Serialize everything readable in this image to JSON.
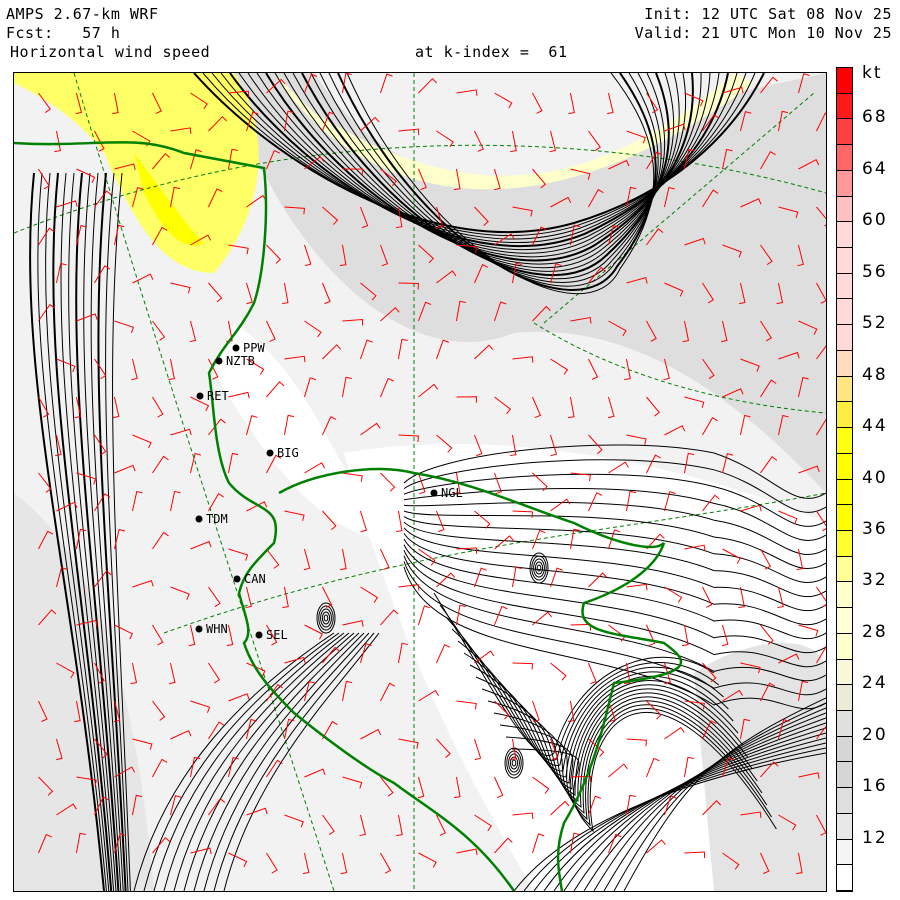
{
  "header": {
    "model": "AMPS 2.67-km WRF",
    "forecast": "Fcst:   57 h",
    "field": "Horizontal wind speed",
    "level": "at k-index =  61",
    "init": "Init: 12 UTC Sat 08 Nov 25",
    "valid": "Valid: 21 UTC Mon 10 Nov 25"
  },
  "colorbar": {
    "units": "kt",
    "labels": [
      "68",
      "64",
      "60",
      "56",
      "52",
      "48",
      "44",
      "40",
      "36",
      "32",
      "28",
      "24",
      "20",
      "16",
      "12"
    ],
    "range_kt": [
      8,
      72
    ],
    "step_kt": 2,
    "colors": [
      "#ff0000",
      "#ff1a1a",
      "#ff4040",
      "#ff6666",
      "#ff9999",
      "#ffc0c0",
      "#ffd8d8",
      "#ffd8d8",
      "#ffd8d8",
      "#ffd8d8",
      "#ffd8d8",
      "#ffdcc0",
      "#ffe680",
      "#ffee40",
      "#ffff10",
      "#ffff00",
      "#ffff00",
      "#ffff00",
      "#ffff30",
      "#ffff99",
      "#ffffcc",
      "#ffffd8",
      "#ffffcc",
      "#f8f8d8",
      "#ebebd8",
      "#e0e0dc",
      "#d6d6d6",
      "#d6d6d6",
      "#dedede",
      "#e8e8e8",
      "#f5f5f5",
      "#ffffff"
    ]
  },
  "stations": [
    {
      "code": "PPW"
    },
    {
      "code": "NZTB"
    },
    {
      "code": "RET"
    },
    {
      "code": "BIG"
    },
    {
      "code": "TDM"
    },
    {
      "code": "CAN"
    },
    {
      "code": "WHN"
    },
    {
      "code": "SEL"
    },
    {
      "code": "NGL"
    }
  ],
  "colors": {
    "coast": "#008000",
    "barb": "#ff0000",
    "stream": "#000000",
    "grid": "#008000"
  }
}
